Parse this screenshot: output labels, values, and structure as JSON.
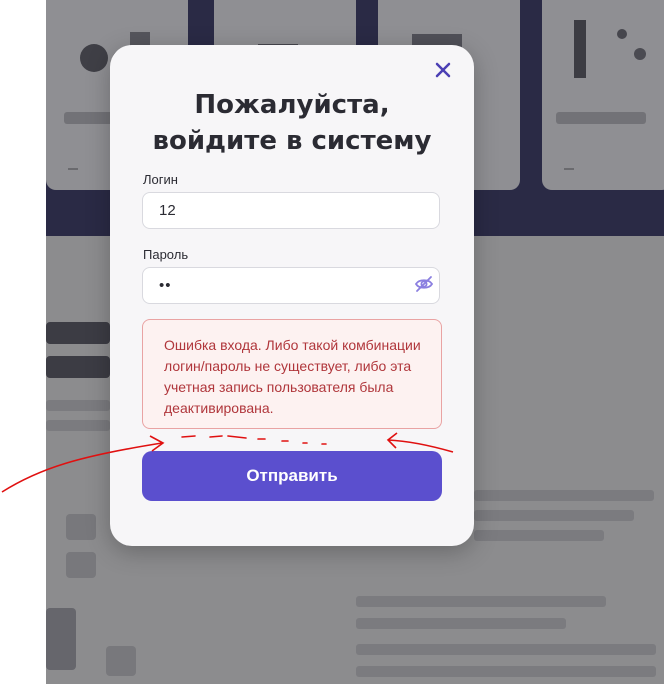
{
  "modal": {
    "title_line1": "Пожалуйста,",
    "title_line2": "войдите в систему",
    "login_label": "Логин",
    "login_value": "12",
    "password_label": "Пароль",
    "password_value": "••",
    "error_message": "Ошибка входа. Либо такой комбинации логин/пароль не существует, либо эта учетная запись пользователя была деактивирована.",
    "submit_label": "Отправить"
  },
  "colors": {
    "accent": "#5b4fce",
    "error_text": "#b0363b",
    "error_border": "#e9a3a3",
    "annotation": "#e01010"
  },
  "icons": {
    "close": "close-icon",
    "password_visibility": "eye-off-icon"
  }
}
